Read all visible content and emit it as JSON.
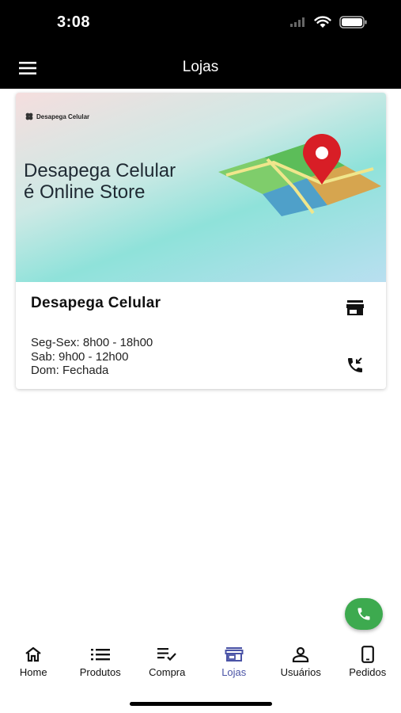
{
  "status_bar": {
    "time": "3:08"
  },
  "app_bar": {
    "title": "Lojas",
    "menu_icon": "hamburger-menu-icon"
  },
  "store": {
    "banner": {
      "brand": "Desapega Celular",
      "headline_line1": "Desapega Celular",
      "headline_line2": "é Online Store"
    },
    "name": "Desapega Celular",
    "hours": [
      "Seg-Sex: 8h00 - 18h00",
      "Sab: 9h00 - 12h00",
      "Dom: Fechada"
    ],
    "store_icon": "storefront-icon",
    "call_icon": "phone-callback-icon"
  },
  "fab": {
    "icon": "phone-icon",
    "color": "#3daa4f"
  },
  "bottom_nav": {
    "items": [
      {
        "label": "Home",
        "icon": "home-icon"
      },
      {
        "label": "Produtos",
        "icon": "list-icon"
      },
      {
        "label": "Compra",
        "icon": "checklist-icon"
      },
      {
        "label": "Lojas",
        "icon": "store-icon",
        "active": true
      },
      {
        "label": "Usuários",
        "icon": "user-icon"
      },
      {
        "label": "Pedidos",
        "icon": "phone-device-icon"
      }
    ],
    "active_color": "#4a53a6"
  }
}
